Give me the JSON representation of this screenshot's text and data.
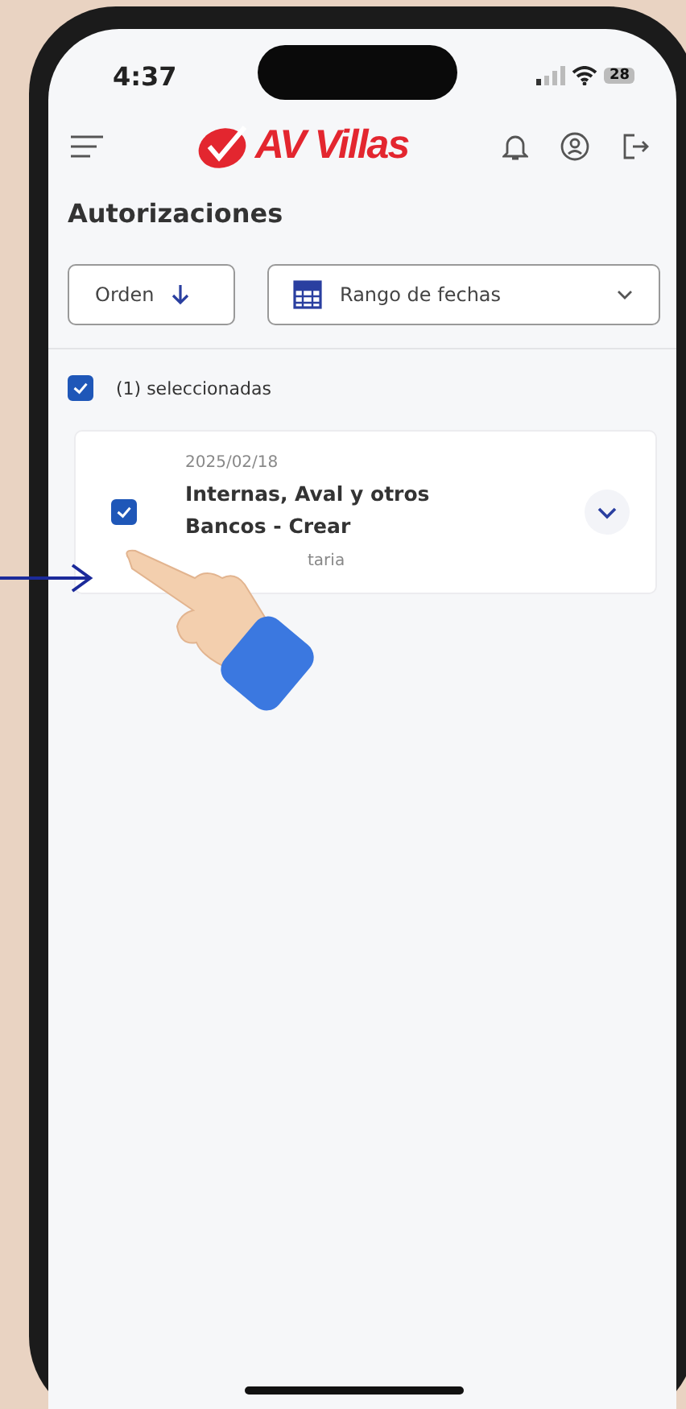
{
  "status_bar": {
    "time": "4:37",
    "battery": "28"
  },
  "header": {
    "logo": "AV Villas"
  },
  "page": {
    "title": "Autorizaciones"
  },
  "filters": {
    "order_button": "Orden",
    "date_range": {
      "placeholder": "Rango de fechas"
    }
  },
  "selection": {
    "label": "(1) seleccionadas",
    "checked": true
  },
  "items": [
    {
      "date": "2025/02/18",
      "title": "Internas, Aval y otros Bancos - Crear",
      "subtitle": "taria",
      "checked": true,
      "expanded": false
    }
  ]
}
